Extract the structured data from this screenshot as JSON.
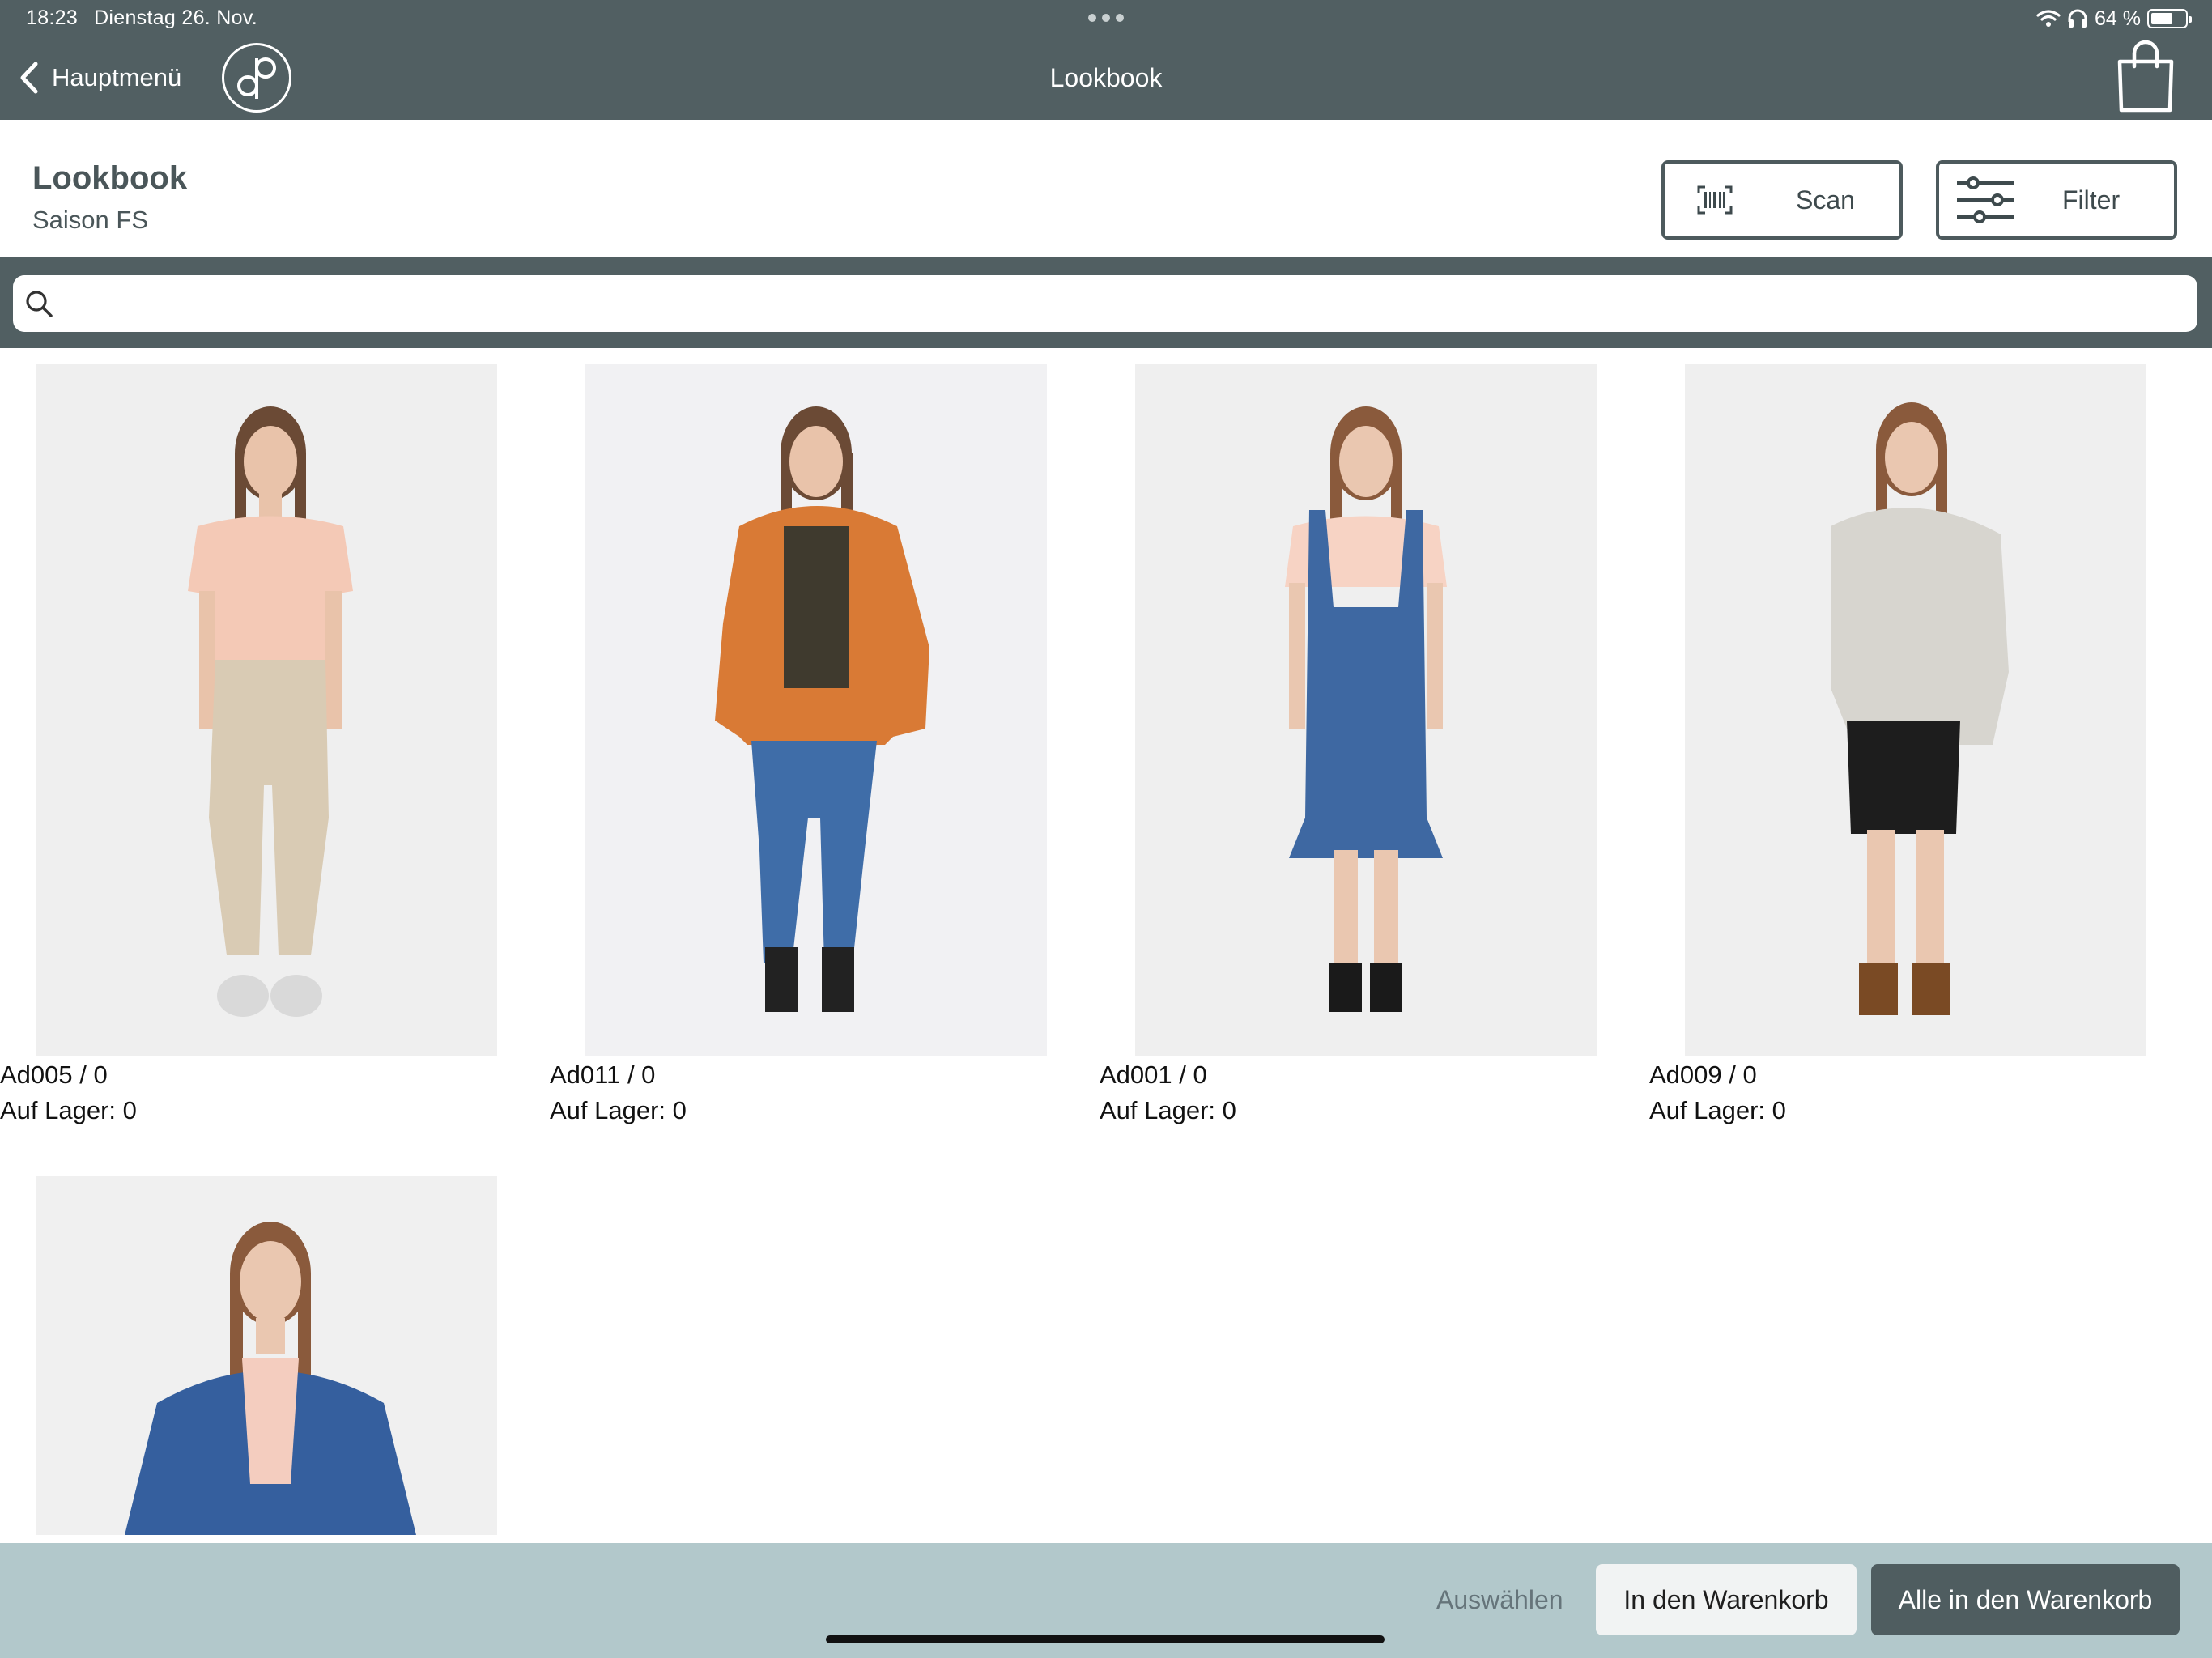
{
  "status_bar": {
    "time": "18:23",
    "date": "Dienstag 26. Nov.",
    "battery": "64 %",
    "battery_level": 0.64,
    "icons": [
      "wifi-icon",
      "headphones-icon",
      "battery-icon"
    ]
  },
  "nav": {
    "back_label": "Hauptmenü",
    "title": "Lookbook",
    "logo_icon": "app-logo-icon",
    "cart_icon": "shopping-bag-icon"
  },
  "header": {
    "title": "Lookbook",
    "subtitle": "Saison FS",
    "scan_label": "Scan",
    "filter_label": "Filter",
    "scan_icon": "barcode-scan-icon",
    "filter_icon": "sliders-icon"
  },
  "search": {
    "placeholder": "",
    "value": "",
    "icon": "search-icon"
  },
  "products": [
    {
      "code": "Ad005 / 0",
      "stock": "Auf Lager: 0",
      "outfit": "Beige T-shirt, beige cargo trousers, sneakers"
    },
    {
      "code": "Ad011 / 0",
      "stock": "Auf Lager: 0",
      "outfit": "Orange puffer jacket, skinny jeans, boots"
    },
    {
      "code": "Ad001 / 0",
      "stock": "Auf Lager: 0",
      "outfit": "Denim pinafore dress, pink T-shirt, sandals"
    },
    {
      "code": "Ad009 / 0",
      "stock": "Auf Lager: 0",
      "outfit": "Grey turtleneck sweater, leather skirt, bronze boots"
    },
    {
      "outfit": "Denim jacket over pink top"
    }
  ],
  "footer": {
    "select_label": "Auswählen",
    "add_to_cart_label": "In den Warenkorb",
    "add_all_label": "Alle in den Warenkorb"
  },
  "colors": {
    "bar": "#515f62",
    "footer": "#b2c8cb",
    "primary_button": "#4f5d60"
  }
}
